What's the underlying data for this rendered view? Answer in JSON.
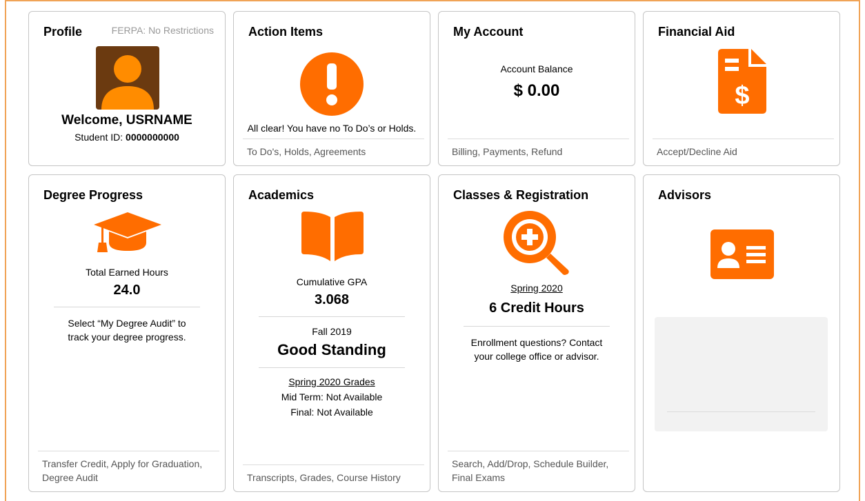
{
  "profile": {
    "title": "Profile",
    "ferpa": "FERPA: No Restrictions",
    "welcome_prefix": "Welcome,",
    "username": "USRNAME",
    "student_id_label": "Student ID:",
    "student_id": "0000000000"
  },
  "action_items": {
    "title": "Action Items",
    "message": "All clear! You have no To Do’s or Holds.",
    "footer": "To Do's, Holds, Agreements"
  },
  "my_account": {
    "title": "My Account",
    "balance_label": "Account Balance",
    "balance": "$ 0.00",
    "footer": "Billing, Payments, Refund"
  },
  "financial_aid": {
    "title": "Financial Aid",
    "footer": "Accept/Decline Aid"
  },
  "degree_progress": {
    "title": "Degree Progress",
    "hours_label": "Total Earned Hours",
    "hours": "24.0",
    "note_line1": "Select “My Degree Audit” to",
    "note_line2": "track your degree progress.",
    "footer_line1": "Transfer Credit, Apply for Graduation,",
    "footer_line2": "Degree Audit"
  },
  "academics": {
    "title": "Academics",
    "gpa_label": "Cumulative GPA",
    "gpa": "3.068",
    "term": "Fall 2019",
    "standing": "Good Standing",
    "grades_link": "Spring 2020 Grades",
    "midterm": "Mid Term: Not Available",
    "final": "Final: Not Available",
    "footer": "Transcripts, Grades, Course History"
  },
  "classes": {
    "title": "Classes & Registration",
    "term_link": "Spring 2020",
    "credits": "6 Credit Hours",
    "note_line1": "Enrollment questions? Contact",
    "note_line2": "your college office or advisor.",
    "footer_line1": "Search, Add/Drop, Schedule Builder,",
    "footer_line2": "Final Exams"
  },
  "advisors": {
    "title": "Advisors"
  },
  "colors": {
    "accent": "#ff6d00",
    "avatar_bg": "#6b3a10",
    "frame": "#f0a356"
  }
}
